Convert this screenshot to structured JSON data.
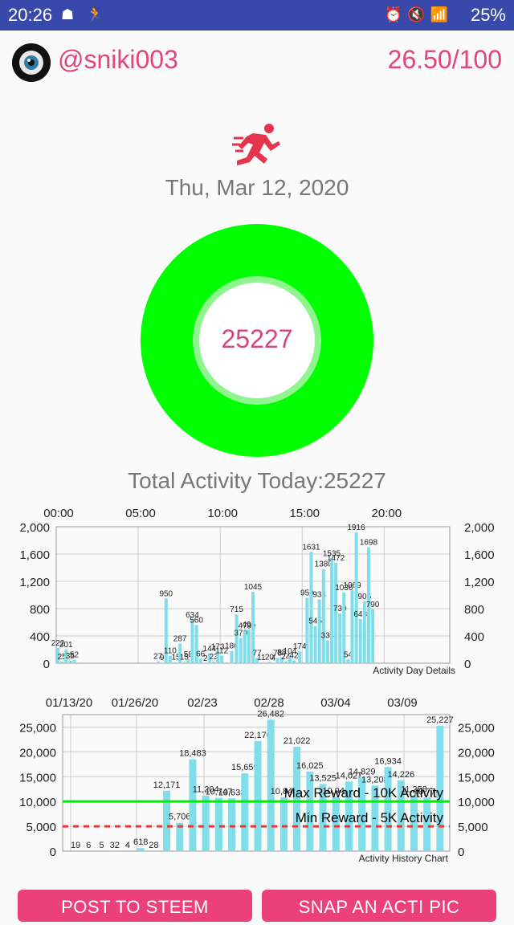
{
  "status_bar": {
    "time": "20:26",
    "battery": "25%"
  },
  "header": {
    "username": "@sniki003",
    "score": "26.50/100"
  },
  "activity_date": "Thu, Mar 12, 2020",
  "ring_value": "25227",
  "total_activity": "Total Activity Today:25227",
  "colors": {
    "accent": "#e0457b",
    "ring": "#00ff00",
    "bar": "#80deea",
    "max_line": "#00ee00",
    "min_line": "#e53935",
    "status_bar": "#3949ab",
    "button": "#ec407a"
  },
  "icons": [
    "runner-icon",
    "accessibility-icon",
    "alarm-icon",
    "mute-icon",
    "wifi-icon",
    "signal-icon",
    "avatar-eye"
  ],
  "chart_data": [
    {
      "type": "bar",
      "x_tick_labels": [
        "00:00",
        "05:00",
        "10:00",
        "15:00",
        "20:00"
      ],
      "y_ticks": [
        "0",
        "400",
        "800",
        "1,200",
        "1,600",
        "2,000"
      ],
      "ylim": [
        0,
        2000
      ],
      "legend": "Activity Day Details",
      "bars": [
        {
          "x": 0.1,
          "y": 222,
          "label": "222"
        },
        {
          "x": 0.35,
          "y": 25,
          "label": "25"
        },
        {
          "x": 0.6,
          "y": 201,
          "label": "201"
        },
        {
          "x": 0.85,
          "y": 35,
          "label": "35"
        },
        {
          "x": 1.1,
          "y": 52,
          "label": "52"
        },
        {
          "x": 6.2,
          "y": 27,
          "label": "27"
        },
        {
          "x": 6.45,
          "y": 9,
          "label": "9"
        },
        {
          "x": 6.7,
          "y": 950,
          "label": "950"
        },
        {
          "x": 6.95,
          "y": 110,
          "label": "110"
        },
        {
          "x": 7.3,
          "y": 15,
          "label": "15"
        },
        {
          "x": 7.55,
          "y": 287,
          "label": "287"
        },
        {
          "x": 7.8,
          "y": 15,
          "label": "15"
        },
        {
          "x": 8.05,
          "y": 58,
          "label": "58"
        },
        {
          "x": 8.3,
          "y": 634,
          "label": "634"
        },
        {
          "x": 8.55,
          "y": 560,
          "label": "560"
        },
        {
          "x": 8.8,
          "y": 66,
          "label": "66"
        },
        {
          "x": 9.1,
          "y": 2,
          "label": "2"
        },
        {
          "x": 9.35,
          "y": 144,
          "label": "144"
        },
        {
          "x": 9.6,
          "y": 23,
          "label": "23"
        },
        {
          "x": 9.85,
          "y": 173,
          "label": "173"
        },
        {
          "x": 10.1,
          "y": 112,
          "label": "112"
        },
        {
          "x": 10.7,
          "y": 180,
          "label": "180"
        },
        {
          "x": 11.0,
          "y": 715,
          "label": "715"
        },
        {
          "x": 11.25,
          "y": 370,
          "label": "370"
        },
        {
          "x": 11.5,
          "y": 479,
          "label": "479"
        },
        {
          "x": 11.75,
          "y": 495,
          "label": "495"
        },
        {
          "x": 12.0,
          "y": 1045,
          "label": "1045"
        },
        {
          "x": 12.25,
          "y": 77,
          "label": "77"
        },
        {
          "x": 12.5,
          "y": 11,
          "label": "11"
        },
        {
          "x": 13.0,
          "y": 20,
          "label": "20"
        },
        {
          "x": 13.25,
          "y": 4,
          "label": "4"
        },
        {
          "x": 13.5,
          "y": 78,
          "label": "78"
        },
        {
          "x": 13.75,
          "y": 88,
          "label": "88"
        },
        {
          "x": 14.0,
          "y": 24,
          "label": "24"
        },
        {
          "x": 14.25,
          "y": 104,
          "label": "104"
        },
        {
          "x": 14.5,
          "y": 42,
          "label": "42"
        },
        {
          "x": 14.85,
          "y": 174,
          "label": "174"
        },
        {
          "x": 15.3,
          "y": 959,
          "label": "959"
        },
        {
          "x": 15.55,
          "y": 1631,
          "label": "1631"
        },
        {
          "x": 15.8,
          "y": 545,
          "label": "545"
        },
        {
          "x": 16.05,
          "y": 934,
          "label": "934"
        },
        {
          "x": 16.3,
          "y": 1380,
          "label": "1380"
        },
        {
          "x": 16.55,
          "y": 334,
          "label": "334"
        },
        {
          "x": 16.8,
          "y": 1535,
          "label": "1535"
        },
        {
          "x": 17.05,
          "y": 1472,
          "label": "1472"
        },
        {
          "x": 17.3,
          "y": 730,
          "label": "730"
        },
        {
          "x": 17.55,
          "y": 1036,
          "label": "1036"
        },
        {
          "x": 17.8,
          "y": 54,
          "label": "54"
        },
        {
          "x": 18.05,
          "y": 1069,
          "label": "1069"
        },
        {
          "x": 18.3,
          "y": 1916,
          "label": "1916"
        },
        {
          "x": 18.55,
          "y": 648,
          "label": "648"
        },
        {
          "x": 18.8,
          "y": 906,
          "label": "906"
        },
        {
          "x": 19.05,
          "y": 1698,
          "label": "1698"
        },
        {
          "x": 19.3,
          "y": 790,
          "label": "790"
        }
      ]
    },
    {
      "type": "bar",
      "x_tick_labels": [
        "01/13/20",
        "01/26/20",
        "02/23",
        "02/28",
        "03/04",
        "03/09"
      ],
      "y_ticks": [
        "0",
        "5,000",
        "10,000",
        "15,000",
        "20,000",
        "25,000"
      ],
      "ylim": [
        0,
        27500
      ],
      "legend": "Activity History Chart",
      "bars": [
        {
          "label": "19",
          "value": 19
        },
        {
          "label": "6",
          "value": 6
        },
        {
          "label": "5",
          "value": 5
        },
        {
          "label": "32",
          "value": 32
        },
        {
          "label": "4",
          "value": 4
        },
        {
          "label": "618",
          "value": 618
        },
        {
          "label": "28",
          "value": 28
        },
        {
          "label": "12,171",
          "value": 12171
        },
        {
          "label": "5,706",
          "value": 5706
        },
        {
          "label": "18,483",
          "value": 18483
        },
        {
          "label": "11,204",
          "value": 11204
        },
        {
          "label": "10,747",
          "value": 10747
        },
        {
          "label": "10,633",
          "value": 10633
        },
        {
          "label": "15,659",
          "value": 15659
        },
        {
          "label": "22,170",
          "value": 22170
        },
        {
          "label": "26,482",
          "value": 26482
        },
        {
          "label": "10,843",
          "value": 10843
        },
        {
          "label": "21,022",
          "value": 21022
        },
        {
          "label": "16,025",
          "value": 16025
        },
        {
          "label": "13,525",
          "value": 13525
        },
        {
          "label": "10,940",
          "value": 10940
        },
        {
          "label": "14,027",
          "value": 14027
        },
        {
          "label": "14,829",
          "value": 14829
        },
        {
          "label": "13,208",
          "value": 13208
        },
        {
          "label": "16,934",
          "value": 16934
        },
        {
          "label": "14,226",
          "value": 14226
        },
        {
          "label": "11,258",
          "value": 11258
        },
        {
          "label": "10,776",
          "value": 10776
        },
        {
          "label": "25,227",
          "value": 25227
        }
      ],
      "reference_lines": [
        {
          "label": "Max Reward - 10K Activity",
          "value": 10000,
          "style": "solid"
        },
        {
          "label": "Min Reward - 5K Activity",
          "value": 5000,
          "style": "dashed"
        }
      ]
    }
  ],
  "buttons": {
    "post": "POST TO STEEM",
    "snap": "SNAP AN ACTI PIC"
  }
}
